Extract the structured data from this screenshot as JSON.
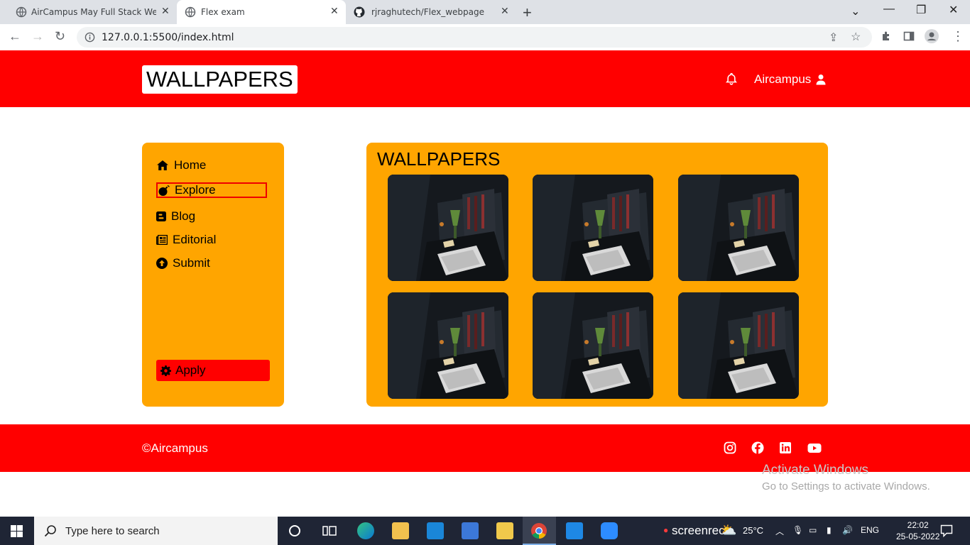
{
  "browser": {
    "tabs": [
      {
        "title": "AirCampus May Full Stack Web D",
        "favicon": "globe-icon",
        "active": false
      },
      {
        "title": "Flex exam",
        "favicon": "globe-icon",
        "active": true
      },
      {
        "title": "rjraghutech/Flex_webpage",
        "favicon": "github-icon",
        "active": false
      }
    ],
    "url": "127.0.0.1:5500/index.html"
  },
  "site": {
    "logo": "WALLPAPERS",
    "user_name": "Aircampus",
    "nav": [
      {
        "label": "Home",
        "icon": "home-icon"
      },
      {
        "label": "Explore",
        "icon": "bomb-icon"
      },
      {
        "label": "Blog",
        "icon": "blogger-icon"
      },
      {
        "label": "Editorial",
        "icon": "newspaper-icon"
      },
      {
        "label": "Submit",
        "icon": "arrow-up-circle-icon"
      }
    ],
    "apply_label": "Apply",
    "gallery_title": "WALLPAPERS",
    "footer_text": "©Aircampus",
    "social_icons": [
      "instagram-icon",
      "facebook-icon",
      "linkedin-icon",
      "youtube-icon"
    ]
  },
  "windows": {
    "activate_title": "Activate Windows",
    "activate_sub": "Go to Settings to activate Windows.",
    "search_placeholder": "Type here to search",
    "recorder": "screenrec",
    "weather": "25°C",
    "language": "ENG",
    "time": "22:02",
    "date": "25-05-2022"
  },
  "colors": {
    "header": "#ff0000",
    "panel": "#ffa500",
    "taskbar": "#1f2535"
  }
}
